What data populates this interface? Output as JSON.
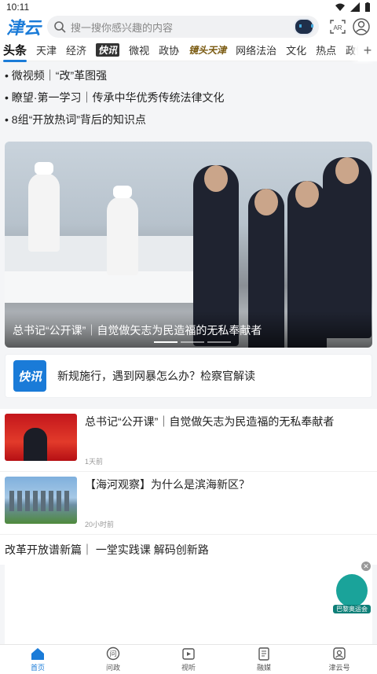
{
  "status": {
    "time": "10:11"
  },
  "header": {
    "logo": "津云",
    "search_placeholder": "搜一搜你感兴趣的内容",
    "ar_label": "AR"
  },
  "tabs": [
    {
      "label": "头条",
      "style": "active"
    },
    {
      "label": "天津",
      "style": ""
    },
    {
      "label": "经济",
      "style": ""
    },
    {
      "label": "快讯",
      "style": "brand"
    },
    {
      "label": "微视",
      "style": ""
    },
    {
      "label": "政协",
      "style": ""
    },
    {
      "label": "镜头天津",
      "style": "brand2"
    },
    {
      "label": "网络法治",
      "style": ""
    },
    {
      "label": "文化",
      "style": ""
    },
    {
      "label": "热点",
      "style": ""
    },
    {
      "label": "政情",
      "style": ""
    }
  ],
  "quick_links": [
    "• 微视频｜“改”革图强",
    "• 瞭望·第一学习｜传承中华优秀传统法律文化",
    "• 8组“开放热词”背后的知识点"
  ],
  "hero": {
    "caption": "总书记“公开课”｜自觉做矢志为民造福的无私奉献者"
  },
  "flash": {
    "badge": "快讯",
    "text": "新规施行，遇到网暴怎么办？检察官解读"
  },
  "news": [
    {
      "title": "总书记“公开课”｜自觉做矢志为民造福的无私奉献者",
      "time": "1天前",
      "thumb": "red"
    },
    {
      "title": "【海河观察】为什么是滨海新区？",
      "time": "20小时前",
      "thumb": "city"
    }
  ],
  "section": {
    "title": "改革开放谱新篇｜ 一堂实践课 解码创新路"
  },
  "olympic": {
    "label": "巴黎奥运会"
  },
  "bottom_nav": [
    {
      "label": "首页",
      "icon": "home-icon",
      "active": true
    },
    {
      "label": "问政",
      "icon": "ask-icon",
      "active": false
    },
    {
      "label": "视听",
      "icon": "video-icon",
      "active": false
    },
    {
      "label": "融媒",
      "icon": "media-icon",
      "active": false
    },
    {
      "label": "津云号",
      "icon": "account-icon",
      "active": false
    }
  ]
}
